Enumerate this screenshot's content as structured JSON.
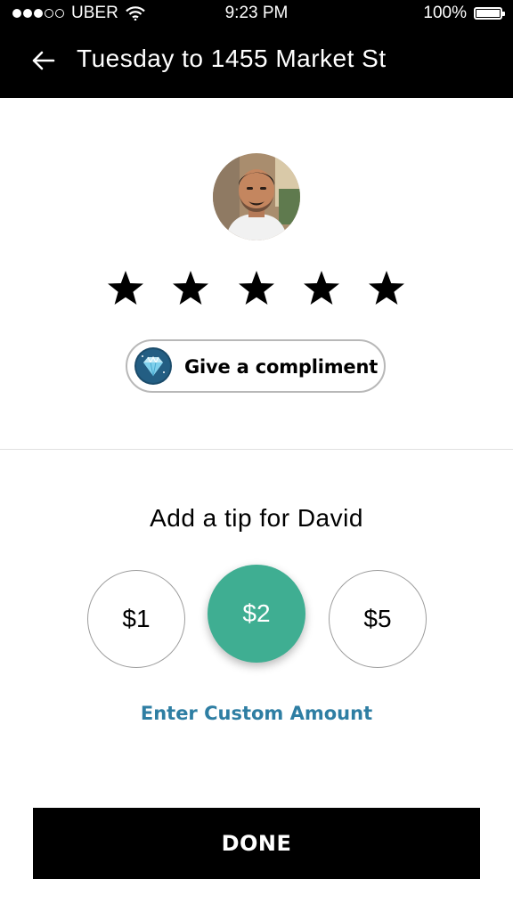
{
  "status_bar": {
    "carrier": "UBER",
    "time": "9:23 PM",
    "battery": "100%",
    "signal_bars_filled": 3,
    "signal_bars_total": 5,
    "battery_level": 1.0
  },
  "header": {
    "title": "Tuesday to 1455 Market St",
    "back_icon": "arrow-left-icon"
  },
  "rating": {
    "stars_total": 5,
    "stars_filled": 5,
    "star_icon": "star-icon"
  },
  "compliment": {
    "label": "Give a compliment",
    "icon": "diamond-icon"
  },
  "tip": {
    "heading": "Add a tip for David",
    "options": [
      "$1",
      "$2",
      "$5"
    ],
    "selected": "$2",
    "custom_label": "Enter Custom Amount"
  },
  "done_label": "DONE",
  "colors": {
    "header_bg": "#000000",
    "accent": "#3fae92",
    "link": "#2e7ea3",
    "button_bg": "#000000"
  }
}
